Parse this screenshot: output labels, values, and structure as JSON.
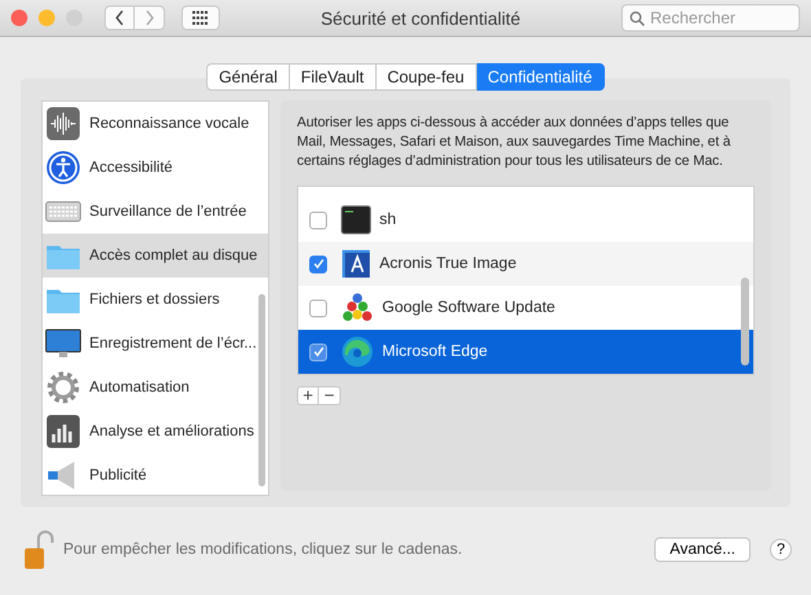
{
  "window": {
    "title": "Sécurité et confidentialité",
    "search": {
      "placeholder": "Rechercher"
    }
  },
  "tabs": [
    {
      "label": "Général",
      "selected": false
    },
    {
      "label": "FileVault",
      "selected": false
    },
    {
      "label": "Coupe-feu",
      "selected": false
    },
    {
      "label": "Confidentialité",
      "selected": true
    }
  ],
  "sidebar": {
    "items": [
      {
        "label": "Reconnaissance vocale",
        "kind": "voice",
        "selected": false
      },
      {
        "label": "Accessibilité",
        "kind": "accessibility",
        "selected": false
      },
      {
        "label": "Surveillance de l’entrée",
        "kind": "keyboard",
        "selected": false
      },
      {
        "label": "Accès complet au disque",
        "kind": "folder",
        "selected": true
      },
      {
        "label": "Fichiers et dossiers",
        "kind": "folder",
        "selected": false
      },
      {
        "label": "Enregistrement de l’écr...",
        "kind": "display",
        "selected": false
      },
      {
        "label": "Automatisation",
        "kind": "gear",
        "selected": false
      },
      {
        "label": "Analyse et améliorations",
        "kind": "chart",
        "selected": false
      },
      {
        "label": "Publicité",
        "kind": "megaphone",
        "selected": false
      }
    ]
  },
  "description": "Autoriser les apps ci-dessous à accéder aux données d’apps telles que Mail, Messages, Safari et Maison, aux sauvegardes Time Machine, et à certains réglages d’administration pour tous les utilisateurs de ce Mac.",
  "apps": [
    {
      "name": "sh",
      "kind": "terminal",
      "checked": false,
      "selected": false
    },
    {
      "name": "Acronis True Image",
      "kind": "acronis",
      "checked": true,
      "selected": false
    },
    {
      "name": "Google Software Update",
      "kind": "balls",
      "checked": false,
      "selected": false
    },
    {
      "name": "Microsoft Edge",
      "kind": "edge",
      "checked": true,
      "selected": true
    }
  ],
  "list_buttons": [
    "+",
    "−"
  ],
  "footer": {
    "lock_text": "Pour empêcher les modifications, cliquez sur le cadenas.",
    "advanced_button": "Avancé...",
    "help_button": "?"
  }
}
